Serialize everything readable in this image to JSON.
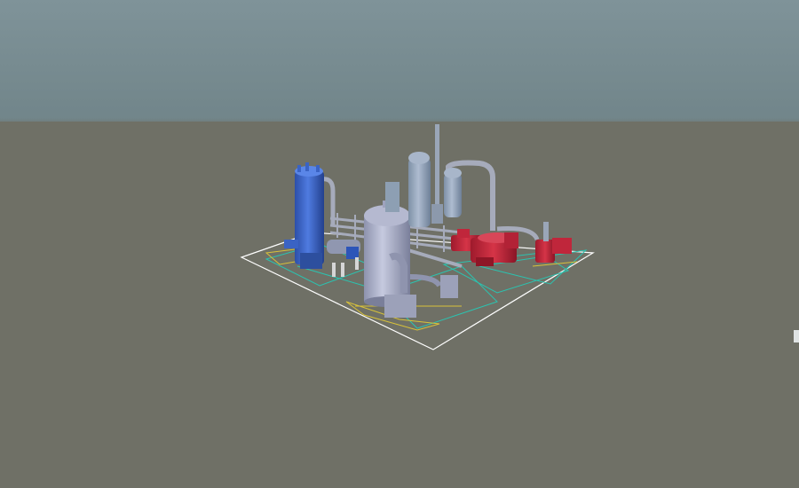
{
  "viewer": {
    "sky_color": "#75898e",
    "ground_color": "#6f7066",
    "model": {
      "equipment": [
        {
          "kind": "column",
          "color": "#3a63c4"
        },
        {
          "kind": "vessel",
          "color": "#a9aec6"
        },
        {
          "kind": "tower",
          "color": "#8d9fb3"
        },
        {
          "kind": "stack",
          "color": "#9aa6b8"
        },
        {
          "kind": "pump-skid",
          "color": "#c0263b"
        },
        {
          "kind": "pipe-rack",
          "color": "#9aa0b0"
        },
        {
          "kind": "footprint-outline",
          "color": "#ffffff"
        }
      ]
    }
  }
}
